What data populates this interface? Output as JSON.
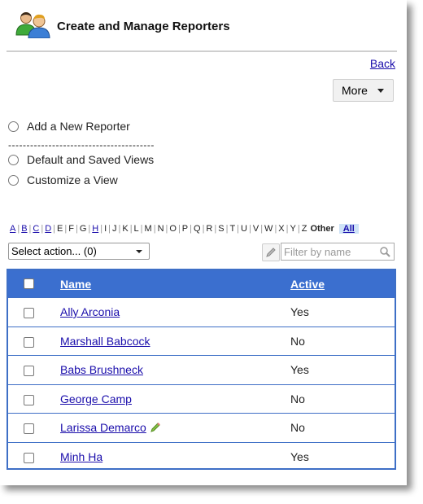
{
  "header": {
    "title": "Create and Manage Reporters",
    "icon": "users-icon"
  },
  "nav": {
    "back_label": "Back",
    "more_label": "More"
  },
  "options": [
    {
      "label": "Add a New Reporter"
    },
    {
      "separator": "----------------------------------------"
    },
    {
      "label": "Default and Saved Views"
    },
    {
      "label": "Customize a View"
    }
  ],
  "alpha": {
    "letters": [
      "A",
      "B",
      "C",
      "D",
      "E",
      "F",
      "G",
      "H",
      "I",
      "J",
      "K",
      "L",
      "M",
      "N",
      "O",
      "P",
      "Q",
      "R",
      "S",
      "T",
      "U",
      "V",
      "W",
      "X",
      "Y",
      "Z"
    ],
    "linked": [
      "A",
      "B",
      "C",
      "D",
      "H"
    ],
    "other": "Other",
    "all": "All"
  },
  "toolbar": {
    "select_action": "Select action... (0)",
    "filter_placeholder": "Filter by name"
  },
  "table": {
    "columns": {
      "name": "Name",
      "active": "Active"
    },
    "rows": [
      {
        "name": "Ally Arconia",
        "active": "Yes",
        "edit_icon": false
      },
      {
        "name": "Marshall Babcock",
        "active": "No",
        "edit_icon": false
      },
      {
        "name": "Babs Brushneck",
        "active": "Yes",
        "edit_icon": false
      },
      {
        "name": "George Camp",
        "active": "No",
        "edit_icon": false
      },
      {
        "name": "Larissa Demarco",
        "active": "No",
        "edit_icon": true
      },
      {
        "name": "Minh Ha",
        "active": "Yes",
        "edit_icon": false
      }
    ]
  },
  "colors": {
    "accent": "#3b6fcf",
    "link": "#1a0dab",
    "all_bg": "#cfe3f7"
  }
}
